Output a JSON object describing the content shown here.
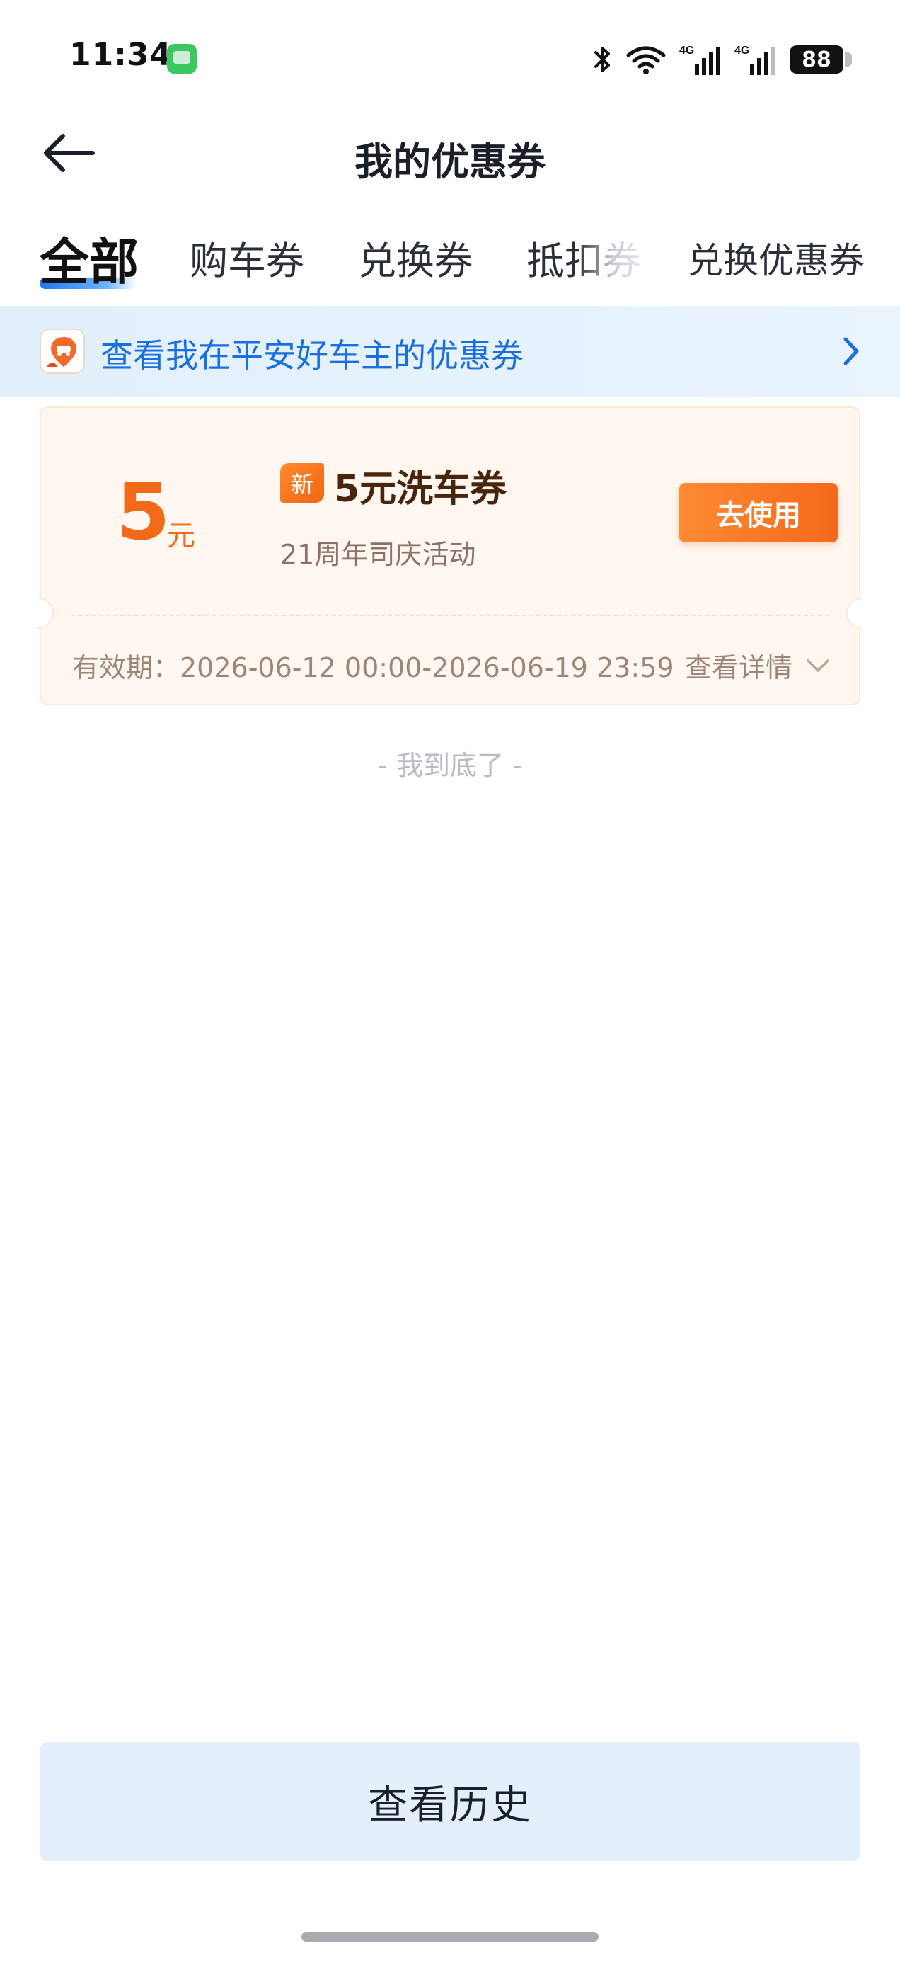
{
  "status_bar": {
    "time": "11:34",
    "battery": "88",
    "icons": [
      "message-app-icon",
      "bluetooth-icon",
      "wifi-icon",
      "signal-4g-icon",
      "signal-4g-icon",
      "battery-icon"
    ]
  },
  "header": {
    "title": "我的优惠券",
    "back_icon": "arrow-left-icon"
  },
  "tabs": [
    {
      "label": "全部",
      "active": true
    },
    {
      "label": "购车券",
      "active": false
    },
    {
      "label": "兑换券",
      "active": false
    },
    {
      "label": "抵扣券",
      "active": false
    },
    {
      "label": "兑换优惠券",
      "active": false
    }
  ],
  "banner": {
    "text": "查看我在平安好车主的优惠券",
    "icon": "pingan-car-owner-logo",
    "arrow_icon": "chevron-right-icon"
  },
  "coupons": [
    {
      "amount": "5",
      "unit": "元",
      "badge": "新",
      "title": "5元洗车券",
      "subtitle": "21周年司庆活动",
      "action_label": "去使用",
      "validity": "有效期：2026-06-12 00:00-2026-06-19 23:59",
      "details_label": "查看详情"
    }
  ],
  "list_end_text": "- 我到底了 -",
  "history_button": "查看历史",
  "colors": {
    "accent_blue": "#1a6fe0",
    "coupon_orange": "#f26a17",
    "coupon_bg": "#fff7f0",
    "banner_bg": "#e2f0fc"
  }
}
